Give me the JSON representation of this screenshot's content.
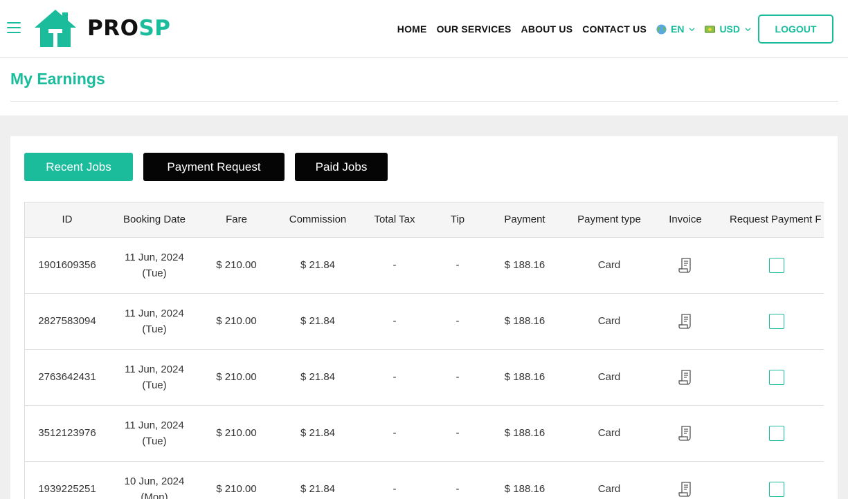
{
  "brand": {
    "name_part1": "PRO",
    "name_part2": "SP",
    "accent": "#1abc9c"
  },
  "nav": {
    "links": [
      "HOME",
      "OUR SERVICES",
      "ABOUT US",
      "CONTACT US"
    ],
    "language": "EN",
    "currency": "USD",
    "logout_label": "LOGOUT"
  },
  "page": {
    "title": "My Earnings"
  },
  "tabs": [
    {
      "label": "Recent Jobs",
      "active": true
    },
    {
      "label": "Payment Request",
      "active": false
    },
    {
      "label": "Paid Jobs",
      "active": false
    }
  ],
  "table": {
    "headers": [
      "ID",
      "Booking Date",
      "Fare",
      "Commission",
      "Total Tax",
      "Tip",
      "Payment",
      "Payment type",
      "Invoice",
      "Request Payment F"
    ],
    "rows": [
      {
        "id": "1901609356",
        "date": "11 Jun, 2024",
        "day": "(Tue)",
        "fare": "$ 210.00",
        "commission": "$ 21.84",
        "tax": "-",
        "tip": "-",
        "payment": "$ 188.16",
        "type": "Card"
      },
      {
        "id": "2827583094",
        "date": "11 Jun, 2024",
        "day": "(Tue)",
        "fare": "$ 210.00",
        "commission": "$ 21.84",
        "tax": "-",
        "tip": "-",
        "payment": "$ 188.16",
        "type": "Card"
      },
      {
        "id": "2763642431",
        "date": "11 Jun, 2024",
        "day": "(Tue)",
        "fare": "$ 210.00",
        "commission": "$ 21.84",
        "tax": "-",
        "tip": "-",
        "payment": "$ 188.16",
        "type": "Card"
      },
      {
        "id": "3512123976",
        "date": "11 Jun, 2024",
        "day": "(Tue)",
        "fare": "$ 210.00",
        "commission": "$ 21.84",
        "tax": "-",
        "tip": "-",
        "payment": "$ 188.16",
        "type": "Card"
      },
      {
        "id": "1939225251",
        "date": "10 Jun, 2024",
        "day": "(Mon)",
        "fare": "$ 210.00",
        "commission": "$ 21.84",
        "tax": "-",
        "tip": "-",
        "payment": "$ 188.16",
        "type": "Card"
      }
    ]
  },
  "icons": {
    "menu": "hamburger-icon",
    "logo": "house-logo-icon",
    "language": "globe-icon",
    "currency": "cash-icon",
    "invoice": "receipt-icon",
    "dropdown": "chevron-down-icon"
  }
}
